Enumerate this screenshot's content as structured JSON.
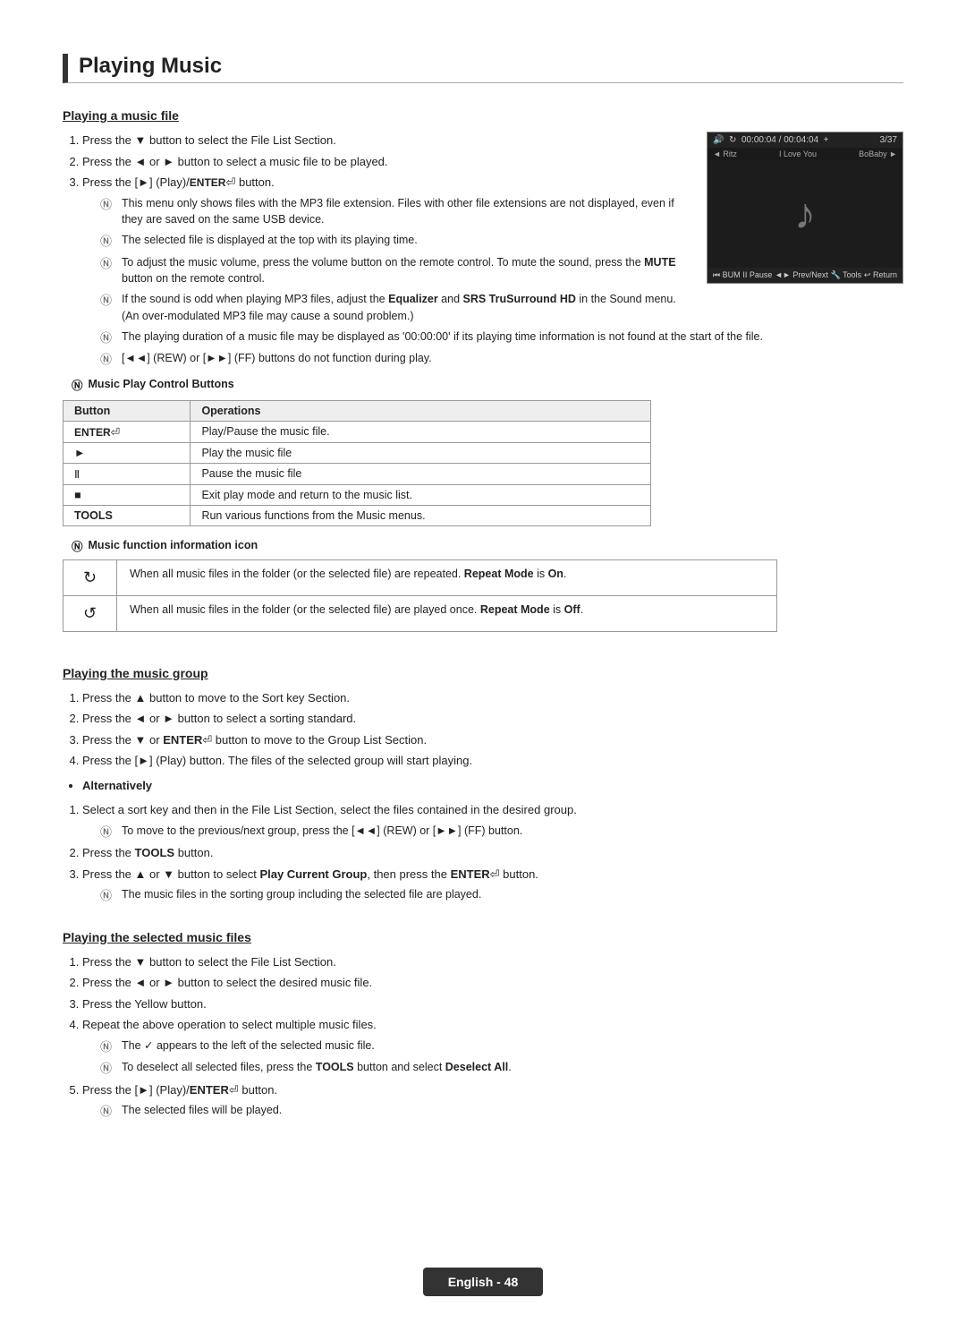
{
  "page": {
    "title": "Playing Music",
    "footer": "English - 48"
  },
  "sections": {
    "playing_music_file": {
      "title": "Playing a music file",
      "steps": [
        "Press the ▼ button to select the File List Section.",
        "Press the ◄ or ► button to select a music file to be played.",
        "Press the [►] (Play)/ENTER⏎ button."
      ],
      "notes": [
        "This menu only shows files with the MP3 file extension. Files with other file extensions are not displayed, even if they are saved on the same USB device.",
        "The selected file is displayed at the top with its playing time.",
        "To adjust the music volume, press the volume button on the remote control. To mute the sound, press the MUTE button on the remote control.",
        "If the sound is odd when playing MP3 files, adjust the Equalizer and SRS TruSurround HD in the Sound menu. (An over-modulated MP3 file may cause a sound problem.)",
        "The playing duration of a music file may be displayed as '00:00:00' if its playing time information is not found at the start of the file.",
        "[◄◄] (REW) or [►►] (FF) buttons do not function during play."
      ],
      "ctrl_table_header": "Music Play Control Buttons",
      "ctrl_table_cols": [
        "Button",
        "Operations"
      ],
      "ctrl_table_rows": [
        [
          "ENTER⏎",
          "Play/Pause the music file."
        ],
        [
          "►",
          "Play the music file"
        ],
        [
          "II",
          "Pause the music file"
        ],
        [
          "■",
          "Exit play mode and return to the music list."
        ],
        [
          "TOOLS",
          "Run various functions from the Music menus."
        ]
      ],
      "info_table_header": "Music function information icon",
      "info_table_rows": [
        [
          "↻",
          "When all music files in the folder (or the selected file) are repeated. Repeat Mode is On."
        ],
        [
          "↺",
          "When all music files in the folder (or the selected file) are played once. Repeat Mode is Off."
        ]
      ],
      "screenshot": {
        "topbar_left": "🔊  ↻  00:00:04 / 00:04:04",
        "topbar_right": "3/37",
        "nav_left": "Ritz",
        "nav_center": "I Love You",
        "nav_right": "BoBaby",
        "bottombar": "⏮ BUM   II Pause   ◄► Previous / Next   🔧 Tools   ↩ Return"
      }
    },
    "playing_music_group": {
      "title": "Playing the music group",
      "steps": [
        "Press the ▲ button to move to the Sort key Section.",
        "Press the ◄ or ► button to select a sorting standard.",
        "Press the ▼ or ENTER⏎ button to move to the Group List Section.",
        "Press the [►] (Play) button. The files of the selected group will start playing."
      ],
      "alternatively_label": "Alternatively",
      "alt_step1": "Select a sort key and then in the File List Section, select the files contained in the desired group.",
      "alt_note": "To move to the previous/next group, press the [◄◄] (REW) or [►►] (FF) button.",
      "alt_step2": "Press the TOOLS button.",
      "alt_step3": "Press the ▲ or ▼ button to select Play Current Group, then press the ENTER⏎ button.",
      "alt_note2": "The music files in the sorting group including the selected file are played."
    },
    "playing_selected_files": {
      "title": "Playing the selected music files",
      "steps": [
        "Press the ▼ button to select the File List Section.",
        "Press the ◄ or ► button to select the desired music file.",
        "Press the Yellow button.",
        "Repeat the above operation to select multiple music files.",
        "Press the [►] (Play)/ENTER⏎ button."
      ],
      "step4_notes": [
        "The ✓ appears to the left of the selected music file.",
        "To deselect all selected files, press the TOOLS button and select Deselect All."
      ],
      "step5_note": "The selected files will be played."
    }
  }
}
